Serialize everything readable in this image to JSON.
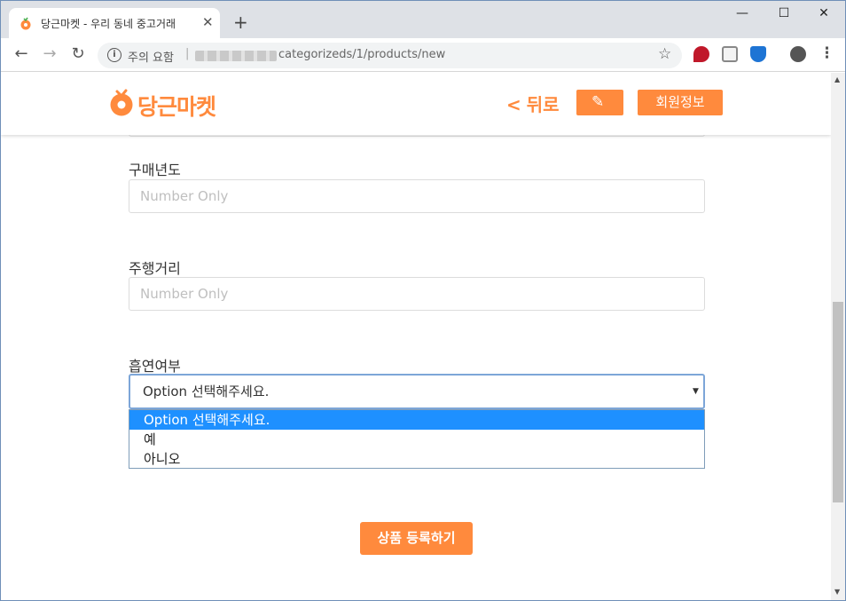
{
  "browser": {
    "tab_title": "당근마켓 - 우리 동네 중고거래",
    "tab_close": "✕",
    "new_tab": "+",
    "window_controls": {
      "minimize": "—",
      "maximize": "☐",
      "close": "✕"
    },
    "security_label": "주의 요함",
    "url_separator": "|",
    "url_path": "categorizeds/1/products/new",
    "icons": [
      "back-arrow-icon",
      "forward-arrow-icon",
      "reload-icon",
      "info-icon",
      "star-icon",
      "extension-icons",
      "menu-icon"
    ]
  },
  "header": {
    "logo_text": "당근마켓",
    "back_label": "뒤로",
    "member_label": "회원정보",
    "accent_color": "#ff8a3d"
  },
  "form": {
    "purchase_year": {
      "label": "구매년도",
      "placeholder": "Number Only"
    },
    "mileage": {
      "label": "주행거리",
      "placeholder": "Number Only"
    },
    "smoking": {
      "label": "흡연여부",
      "selected": "Option 선택해주세요.",
      "options": [
        "Option 선택해주세요.",
        "예",
        "아니오"
      ]
    },
    "submit_label": "상품 등록하기"
  }
}
